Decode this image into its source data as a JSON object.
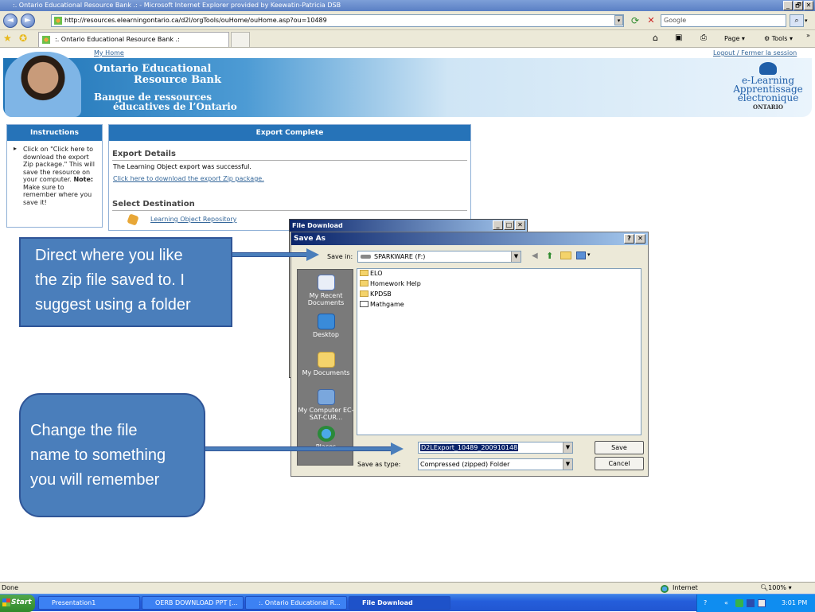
{
  "window": {
    "title": ":. Ontario Educational Resource Bank .: - Microsoft Internet Explorer provided by Keewatin-Patricia DSB",
    "min": "_",
    "max": "🗗",
    "close": "✕"
  },
  "browser": {
    "back_glyph": "◄",
    "forward_glyph": "►",
    "url": "http://resources.elearningontario.ca/d2l/orgTools/ouHome/ouHome.asp?ou=10489",
    "search_placeholder": "Google",
    "tab_label": ":. Ontario Educational Resource Bank .:",
    "page_menu": "Page",
    "tools_menu": "Tools",
    "more_glyph": "»"
  },
  "page": {
    "my_home": "My Home",
    "logout": "Logout / Fermer la session",
    "banner": {
      "line1": "Ontario Educational",
      "line2": "Resource Bank",
      "line3": "Banque de ressources",
      "line4": "éducatives de l’Ontario"
    },
    "elogo": {
      "line1": "e-Learning",
      "line2": "Apprentissage",
      "line3": "électronique",
      "line4": "ONTARIO"
    },
    "instructions": {
      "title": "Instructions",
      "text": "Click on \"Click here to download the export Zip package.\" This will save the resource on your computer.",
      "note_label": "Note:",
      "note_text": "Make sure to remember where you save it!"
    },
    "export": {
      "title": "Export Complete",
      "details_heading": "Export Details",
      "success_text": "The Learning Object export was successful.",
      "download_link": "Click here to download the export Zip package.",
      "destination_heading": "Select Destination",
      "repository_link": "Learning Object Repository"
    }
  },
  "callouts": {
    "top": [
      "Direct where you like",
      "the zip file saved to.  I",
      "suggest using a folder"
    ],
    "bottom": [
      "Change the file",
      "name to something",
      "you will remember"
    ],
    "color": "#4a7ebb"
  },
  "file_download_dialog": {
    "title": "File Download"
  },
  "save_as": {
    "title": "Save As",
    "help": "?",
    "close": "✕",
    "save_in_label": "Save in:",
    "save_in_value": "SPARKWARE (F:)",
    "places": [
      "My Recent Documents",
      "Desktop",
      "My Documents",
      "My Computer EC-SAT-CUR...",
      "Places"
    ],
    "files": [
      "ELO",
      "Homework Help",
      "KPDSB",
      "Mathgame"
    ],
    "file_name_value": "D2LExport_10489_200910148",
    "save_as_type_label": "Save as type:",
    "save_as_type_value": "Compressed (zipped) Folder",
    "save_button": "Save",
    "cancel_button": "Cancel"
  },
  "status_bar": {
    "text": "Done",
    "zone": "Internet",
    "zoom": "100%"
  },
  "taskbar": {
    "start": "Start",
    "tasks": [
      "Presentation1",
      "OERB DOWNLOAD PPT [...",
      ":. Ontario Educational R...",
      "File Download"
    ],
    "clock": "3:01 PM"
  }
}
